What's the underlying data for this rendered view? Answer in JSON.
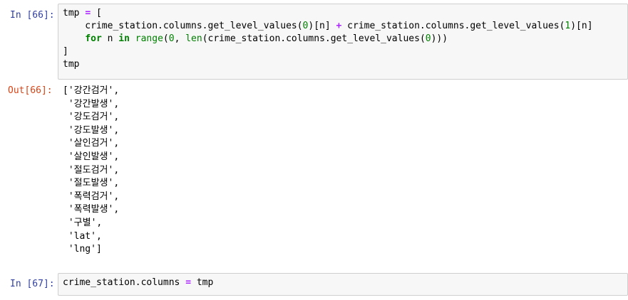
{
  "cells": [
    {
      "prompt": "In [66]:",
      "code_lines": [
        [
          {
            "t": "tmp "
          },
          {
            "t": "=",
            "c": "op"
          },
          {
            "t": " ["
          }
        ],
        [
          {
            "t": "    crime_station.columns.get_level_values("
          },
          {
            "t": "0",
            "c": "num"
          },
          {
            "t": ")[n] "
          },
          {
            "t": "+",
            "c": "op"
          },
          {
            "t": " crime_station.columns.get_level_values("
          },
          {
            "t": "1",
            "c": "num"
          },
          {
            "t": ")[n]"
          }
        ],
        [
          {
            "t": "    "
          },
          {
            "t": "for",
            "c": "kw"
          },
          {
            "t": " n "
          },
          {
            "t": "in",
            "c": "kw"
          },
          {
            "t": " "
          },
          {
            "t": "range",
            "c": "bi"
          },
          {
            "t": "("
          },
          {
            "t": "0",
            "c": "num"
          },
          {
            "t": ", "
          },
          {
            "t": "len",
            "c": "bi"
          },
          {
            "t": "(crime_station.columns.get_level_values("
          },
          {
            "t": "0",
            "c": "num"
          },
          {
            "t": ")))"
          }
        ],
        [
          {
            "t": "]"
          }
        ],
        [
          {
            "t": "tmp"
          }
        ]
      ],
      "output_prompt": "Out[66]:",
      "output_lines": [
        "['강간검거',",
        " '강간발생',",
        " '강도검거',",
        " '강도발생',",
        " '살인검거',",
        " '살인발생',",
        " '절도검거',",
        " '절도발생',",
        " '폭력검거',",
        " '폭력발생',",
        " '구별',",
        " 'lat',",
        " 'lng']"
      ]
    },
    {
      "prompt": "In [67]:",
      "code_lines": [
        [
          {
            "t": "crime_station.columns "
          },
          {
            "t": "=",
            "c": "op"
          },
          {
            "t": " tmp"
          }
        ]
      ]
    }
  ]
}
